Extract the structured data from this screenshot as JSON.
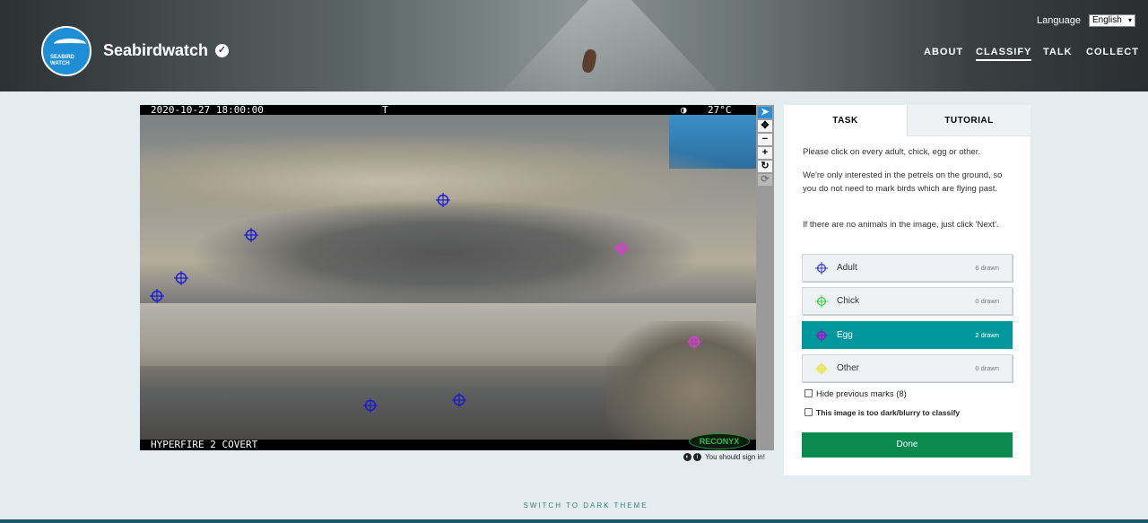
{
  "header": {
    "brand": "Seabirdwatch",
    "logo_text_1": "SEABIRD",
    "logo_text_2": "WATCH",
    "verified_icon": "check-circle-icon",
    "language_label": "Language",
    "language_value": "English",
    "nav": [
      {
        "label": "ABOUT",
        "active": false
      },
      {
        "label": "CLASSIFY",
        "active": true
      },
      {
        "label": "TALK",
        "active": false
      },
      {
        "label": "COLLECT",
        "active": false
      }
    ]
  },
  "camera": {
    "datetime": "2020-10-27 18:00:00",
    "flag": "T",
    "moon_icon": "moon-phase-icon",
    "temperature": "27°C",
    "model": "HYPERFIRE 2 COVERT",
    "brand": "RECONYX"
  },
  "tools": [
    "pointer-icon",
    "move-icon",
    "zoom-out-icon",
    "zoom-in-icon",
    "rotate-icon",
    "reset-icon"
  ],
  "signin_text": "You should sign in!",
  "panel": {
    "tabs": [
      "TASK",
      "TUTORIAL"
    ],
    "instructions": [
      "Please click on every adult, chick, egg or other.",
      "We're only interested in the petrels on the ground, so you do not need to mark birds which are flying past.",
      "If there are no animals in the image, just click 'Next'."
    ],
    "choices": [
      {
        "label": "Adult",
        "count": "6 drawn",
        "color": "#3b3bd6",
        "active": false
      },
      {
        "label": "Chick",
        "count": "0 drawn",
        "color": "#3fd04a",
        "active": false
      },
      {
        "label": "Egg",
        "count": "2 drawn",
        "color": "#9b3fd6",
        "active": true
      },
      {
        "label": "Other",
        "count": "0 drawn",
        "color": "#e6e04a",
        "active": false
      }
    ],
    "hide_marks_label": "Hide previous marks (8)",
    "too_dark_label": "This image is too dark/blurry to classify",
    "done_label": "Done"
  },
  "theme_switch": "SWITCH TO DARK THEME",
  "colors": {
    "accent": "#00979d",
    "done": "#0a8a4f",
    "adult_mark": "#1a1ad6",
    "egg_mark": "#d63fd0"
  }
}
